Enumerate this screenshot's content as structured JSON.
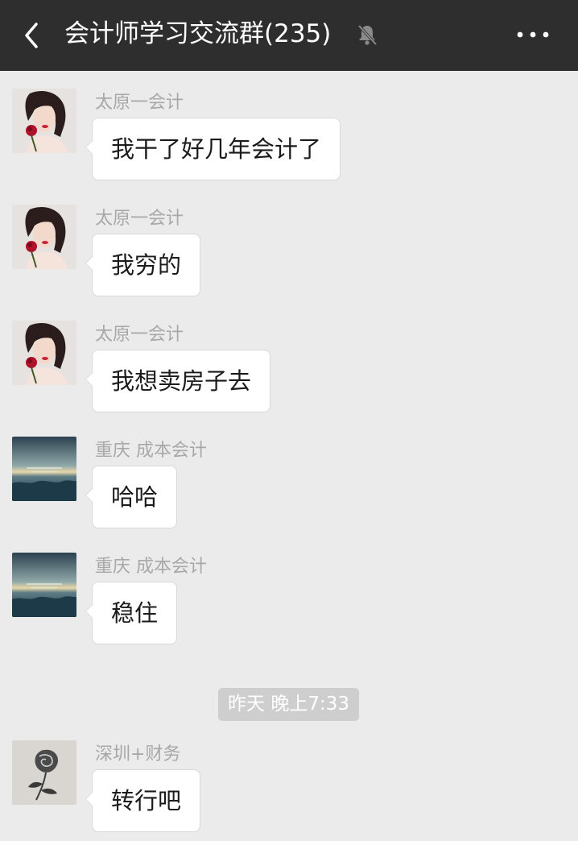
{
  "header": {
    "title": "会计师学习交流群(235)",
    "back_icon": "chevron-left-icon",
    "mute_icon": "bell-muted-icon",
    "more_icon": "more-dots-icon"
  },
  "messages": [
    {
      "sender": "太原一会计",
      "text": "我干了好几年会计了",
      "avatar": "rose-girl-avatar"
    },
    {
      "sender": "太原一会计",
      "text": "我穷的",
      "avatar": "rose-girl-avatar"
    },
    {
      "sender": "太原一会计",
      "text": "我想卖房子去",
      "avatar": "rose-girl-avatar"
    },
    {
      "sender": "重庆 成本会计",
      "text": "哈哈",
      "avatar": "sea-avatar"
    },
    {
      "sender": "重庆 成本会计",
      "text": "稳住",
      "avatar": "sea-avatar"
    },
    {
      "sender": "深圳+财务",
      "text": "转行吧",
      "avatar": "rose-sketch-avatar"
    }
  ],
  "timestamp": "昨天 晚上7:33",
  "colors": {
    "header_bg": "#2e2e2e",
    "chat_bg": "#ebebeb",
    "bubble_bg": "#ffffff",
    "sender_text": "#a8a8a8",
    "timestamp_bg": "#cecece"
  }
}
